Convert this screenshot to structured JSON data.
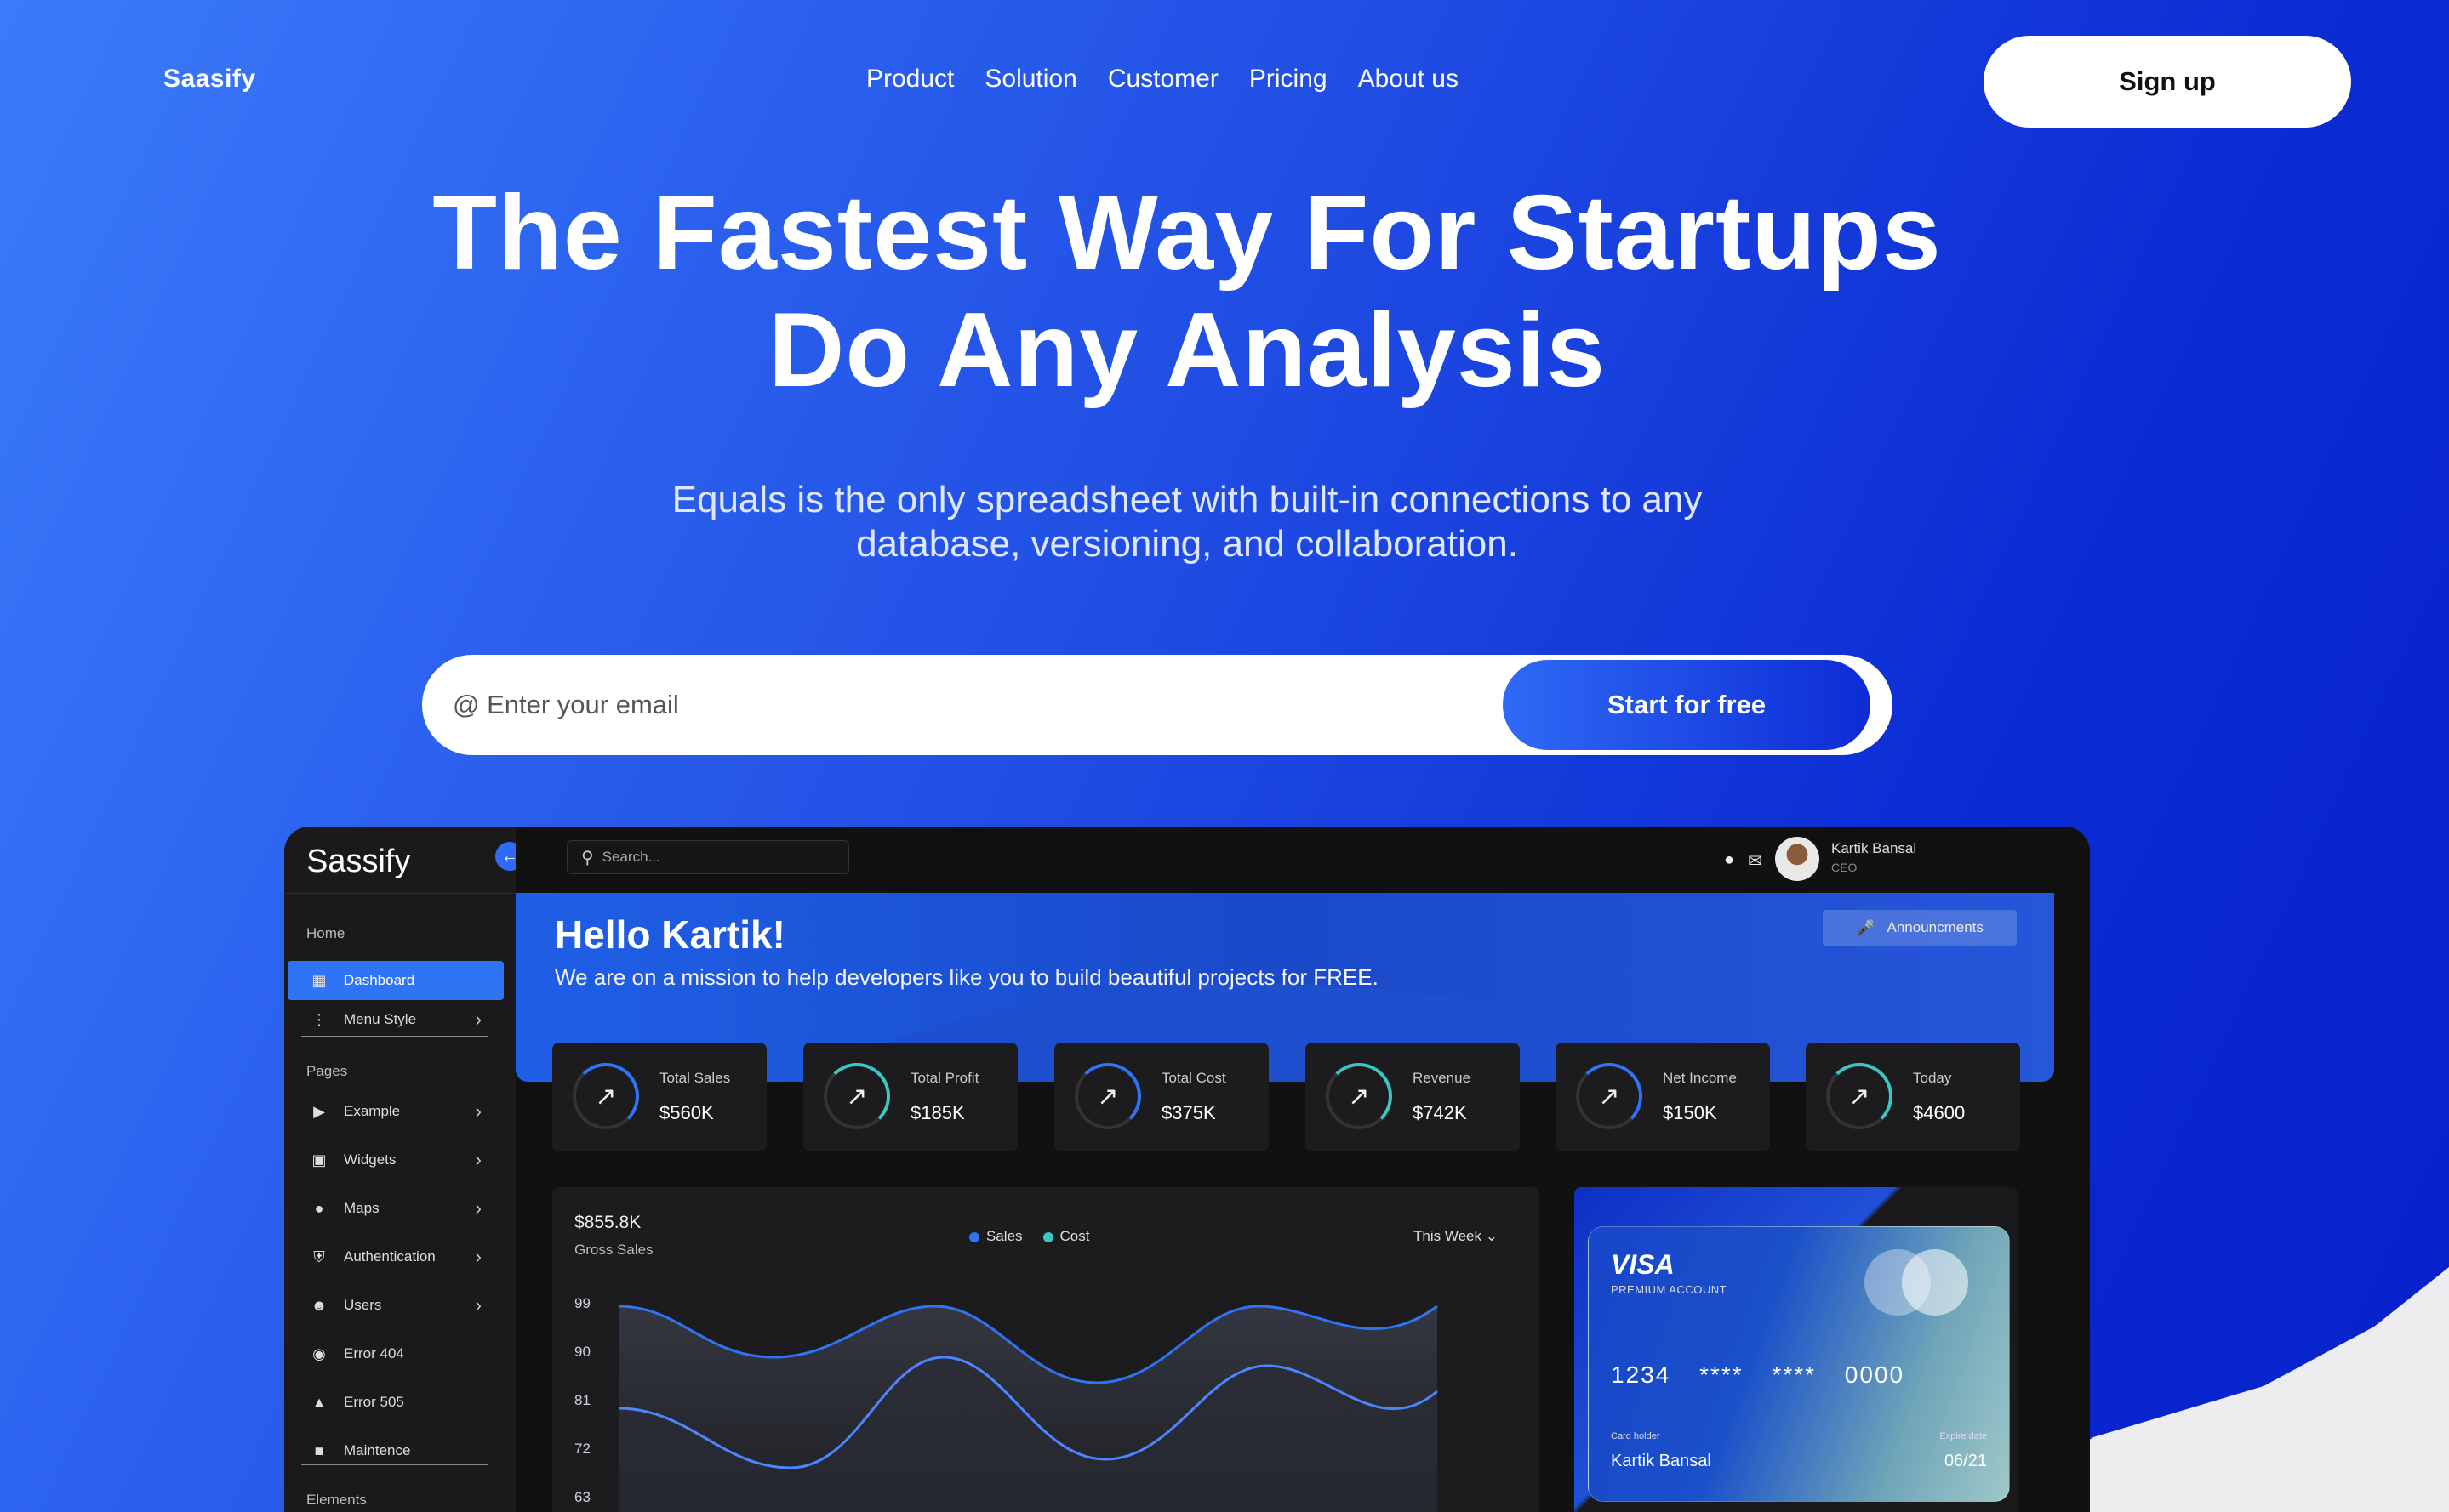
{
  "nav": {
    "brand": "Saasify",
    "links": [
      "Product",
      "Solution",
      "Customer",
      "Pricing",
      "About us"
    ],
    "signup_label": "Sign up"
  },
  "hero": {
    "headline_line1": "The Fastest Way For Startups",
    "headline_line2": "Do Any Analysis",
    "subhead_line1": "Equals is the only spreadsheet with built-in connections to any",
    "subhead_line2": "database, versioning, and collaboration.",
    "email_placeholder": "@ Enter your email",
    "cta_label": "Start for free"
  },
  "dashboard": {
    "logo": "Sassify",
    "search_placeholder": "Search...",
    "user": {
      "name": "Kartik Bansal",
      "role": "CEO"
    },
    "sidebar": {
      "section_home": "Home",
      "home_items": [
        {
          "label": "Dashboard",
          "icon": "grid-icon",
          "active": true
        },
        {
          "label": "Menu Style",
          "icon": "menu-style-icon",
          "chevron": true
        }
      ],
      "section_pages": "Pages",
      "page_items": [
        {
          "label": "Example",
          "icon": "youtube-icon",
          "chevron": true
        },
        {
          "label": "Widgets",
          "icon": "widget-icon",
          "chevron": true
        },
        {
          "label": "Maps",
          "icon": "map-pin-icon",
          "chevron": true
        },
        {
          "label": "Authentication",
          "icon": "shield-icon",
          "chevron": true
        },
        {
          "label": "Users",
          "icon": "users-icon",
          "chevron": true
        },
        {
          "label": "Error 404",
          "icon": "error-icon"
        },
        {
          "label": "Error 505",
          "icon": "warning-icon"
        },
        {
          "label": "Maintence",
          "icon": "doc-icon"
        }
      ],
      "section_elements": "Elements"
    },
    "banner": {
      "greeting": "Hello Kartik!",
      "mission": "We are on a mission to help developers like you to build beautiful projects for FREE.",
      "announce_label": "Announcments"
    },
    "stats": [
      {
        "label": "Total Sales",
        "value": "$560K",
        "ring": "blue"
      },
      {
        "label": "Total Profit",
        "value": "$185K",
        "ring": "teal"
      },
      {
        "label": "Total Cost",
        "value": "$375K",
        "ring": "blue"
      },
      {
        "label": "Revenue",
        "value": "$742K",
        "ring": "teal"
      },
      {
        "label": "Net Income",
        "value": "$150K",
        "ring": "blue"
      },
      {
        "label": "Today",
        "value": "$4600",
        "ring": "teal"
      }
    ],
    "gross": {
      "value": "$855.8K",
      "label": "Gross Sales",
      "period": "This Week"
    },
    "card": {
      "brand": "VISA",
      "type": "PREMIUM ACCOUNT",
      "number": "1234 **** **** 0000",
      "holder_label": "Card holder",
      "holder": "Kartik Bansal",
      "expiry_label": "Expire date",
      "expiry": "06/21"
    },
    "colors": {
      "accent": "#2e74f5",
      "teal": "#3bc6c4"
    }
  },
  "chart_data": {
    "type": "line",
    "yticks": [
      "99",
      "90",
      "81",
      "72",
      "63"
    ],
    "series": [
      {
        "name": "Sales",
        "color": "#2e74f5"
      },
      {
        "name": "Cost",
        "color": "#3bc6c4"
      }
    ]
  }
}
